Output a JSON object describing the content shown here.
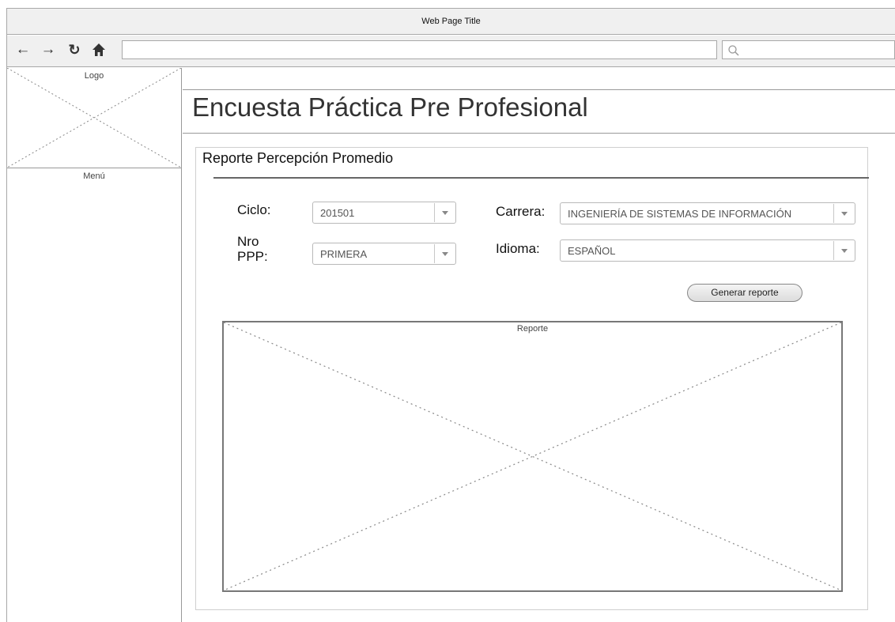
{
  "browser": {
    "title": "Web Page Title",
    "url": "",
    "search_placeholder": ""
  },
  "sidebar": {
    "logo_label": "Logo",
    "menu_label": "Menú"
  },
  "header": {
    "title": "Encuesta Práctica Pre Profesional"
  },
  "panel": {
    "title": "Reporte Percepción Promedio",
    "fields": {
      "ciclo": {
        "label": "Ciclo:",
        "value": "201501"
      },
      "nro_ppp": {
        "label_line1": "Nro",
        "label_line2": "PPP:",
        "value": "PRIMERA"
      },
      "carrera": {
        "label": "Carrera:",
        "value": "INGENIERÍA DE SISTEMAS DE INFORMACIÓN"
      },
      "idioma": {
        "label": "Idioma:",
        "value": "ESPAÑOL"
      }
    },
    "generate_button": "Generar reporte",
    "report_label": "Reporte"
  },
  "colors": {
    "chrome_bg": "#f0f0f0",
    "border": "#a8a8a8",
    "placeholder_line": "#888888"
  }
}
